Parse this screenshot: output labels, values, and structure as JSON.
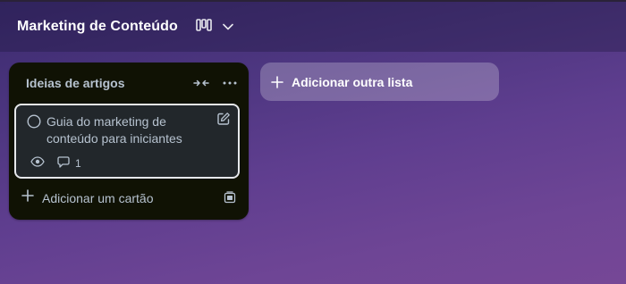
{
  "header": {
    "title": "Marketing de Conteúdo",
    "view_icon": "board-view-icon",
    "dropdown_icon": "chevron-down-icon"
  },
  "list": {
    "title": "Ideias de artigos",
    "collapse_icon": "collapse-arrows-icon",
    "more_icon": "more-horizontal-icon",
    "cards": [
      {
        "title": "Guia do marketing de conteúdo para iniciantes",
        "watch_icon": "eye-icon",
        "comment_icon": "comment-icon",
        "comment_count": "1"
      }
    ],
    "add_card_label": "Adicionar um cartão",
    "template_icon": "card-template-icon"
  },
  "add_list": {
    "label": "Adicionar outra lista"
  },
  "colors": {
    "list_bg": "#101204",
    "card_bg": "#22272b",
    "card_border": "#e6e8ec",
    "text_light": "#b6c2cf",
    "header_text": "#ffffff"
  }
}
